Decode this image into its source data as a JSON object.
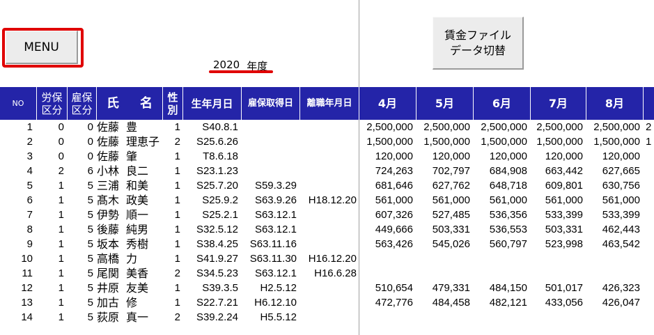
{
  "menu_button": "MENU",
  "year": {
    "value": "2020",
    "unit": "年度"
  },
  "data_button": {
    "line1": "賃金ファイル",
    "line2": "データ切替"
  },
  "headers": {
    "no": "NO",
    "rousai_1": "労保",
    "rousai_2": "区分",
    "koyou_1": "雇保",
    "koyou_2": "区分",
    "name_1": "氏",
    "name_2": "名",
    "gender_1": "性",
    "gender_2": "別",
    "birth": "生年月日",
    "acquired": "雇保取得日",
    "left": "離職年月日",
    "months": [
      "4月",
      "5月",
      "6月",
      "7月",
      "8月"
    ]
  },
  "rows": [
    {
      "no": "1",
      "r": "0",
      "k": "0",
      "sei": "佐藤",
      "mei": "豊",
      "g": "1",
      "birth": "S40.8.1",
      "acq": "",
      "left": "",
      "m": [
        "2,500,000",
        "2,500,000",
        "2,500,000",
        "2,500,000",
        "2,500,000"
      ],
      "extra": "2"
    },
    {
      "no": "2",
      "r": "0",
      "k": "0",
      "sei": "佐藤",
      "mei": "理恵子",
      "g": "2",
      "birth": "S25.6.26",
      "acq": "",
      "left": "",
      "m": [
        "1,500,000",
        "1,500,000",
        "1,500,000",
        "1,500,000",
        "1,500,000"
      ],
      "extra": "1"
    },
    {
      "no": "3",
      "r": "0",
      "k": "0",
      "sei": "佐藤",
      "mei": "肇",
      "g": "1",
      "birth": "T8.6.18",
      "acq": "",
      "left": "",
      "m": [
        "120,000",
        "120,000",
        "120,000",
        "120,000",
        "120,000"
      ],
      "extra": ""
    },
    {
      "no": "4",
      "r": "2",
      "k": "6",
      "sei": "小林",
      "mei": "良二",
      "g": "1",
      "birth": "S23.1.23",
      "acq": "",
      "left": "",
      "m": [
        "724,263",
        "702,797",
        "684,908",
        "663,442",
        "627,665"
      ],
      "extra": ""
    },
    {
      "no": "5",
      "r": "1",
      "k": "5",
      "sei": "三浦",
      "mei": "和美",
      "g": "1",
      "birth": "S25.7.20",
      "acq": "S59.3.29",
      "left": "",
      "m": [
        "681,646",
        "627,762",
        "648,718",
        "609,801",
        "630,756"
      ],
      "extra": ""
    },
    {
      "no": "6",
      "r": "1",
      "k": "5",
      "sei": "髙木",
      "mei": "政美",
      "g": "1",
      "birth": "S25.9.2",
      "acq": "S63.9.26",
      "left": "H18.12.20",
      "m": [
        "561,000",
        "561,000",
        "561,000",
        "561,000",
        "561,000"
      ],
      "extra": ""
    },
    {
      "no": "7",
      "r": "1",
      "k": "5",
      "sei": "伊勢",
      "mei": "順一",
      "g": "1",
      "birth": "S25.2.1",
      "acq": "S63.12.1",
      "left": "",
      "m": [
        "607,326",
        "527,485",
        "536,356",
        "533,399",
        "533,399"
      ],
      "extra": ""
    },
    {
      "no": "8",
      "r": "1",
      "k": "5",
      "sei": "後藤",
      "mei": "純男",
      "g": "1",
      "birth": "S32.5.12",
      "acq": "S63.12.1",
      "left": "",
      "m": [
        "449,666",
        "503,331",
        "536,553",
        "503,331",
        "462,443"
      ],
      "extra": ""
    },
    {
      "no": "9",
      "r": "1",
      "k": "5",
      "sei": "坂本",
      "mei": "秀樹",
      "g": "1",
      "birth": "S38.4.25",
      "acq": "S63.11.16",
      "left": "",
      "m": [
        "563,426",
        "545,026",
        "560,797",
        "523,998",
        "463,542"
      ],
      "extra": ""
    },
    {
      "no": "10",
      "r": "1",
      "k": "5",
      "sei": "高橋",
      "mei": "力",
      "g": "1",
      "birth": "S41.9.27",
      "acq": "S63.11.30",
      "left": "H16.12.20",
      "m": [
        "",
        "",
        "",
        "",
        ""
      ],
      "extra": ""
    },
    {
      "no": "11",
      "r": "1",
      "k": "5",
      "sei": "尾関",
      "mei": "美香",
      "g": "2",
      "birth": "S34.5.23",
      "acq": "S63.12.1",
      "left": "H16.6.28",
      "m": [
        "",
        "",
        "",
        "",
        ""
      ],
      "extra": ""
    },
    {
      "no": "12",
      "r": "1",
      "k": "5",
      "sei": "井原",
      "mei": "友美",
      "g": "1",
      "birth": "S39.3.5",
      "acq": "H2.5.12",
      "left": "",
      "m": [
        "510,654",
        "479,331",
        "484,150",
        "501,017",
        "426,323"
      ],
      "extra": ""
    },
    {
      "no": "13",
      "r": "1",
      "k": "5",
      "sei": "加古",
      "mei": "修",
      "g": "1",
      "birth": "S22.7.21",
      "acq": "H6.12.10",
      "left": "",
      "m": [
        "472,776",
        "484,458",
        "482,121",
        "433,056",
        "426,047"
      ],
      "extra": ""
    },
    {
      "no": "14",
      "r": "1",
      "k": "5",
      "sei": "荻原",
      "mei": "真一",
      "g": "2",
      "birth": "S39.2.24",
      "acq": "H5.5.12",
      "left": "",
      "m": [
        "",
        "",
        "",
        "",
        ""
      ],
      "extra": ""
    }
  ]
}
